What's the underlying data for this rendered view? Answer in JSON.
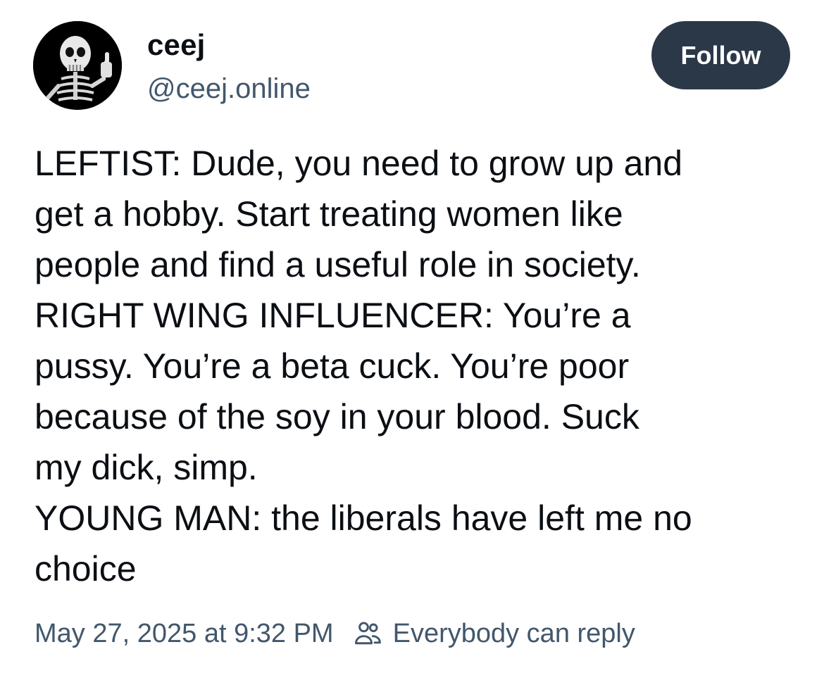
{
  "author": {
    "display_name": "ceej",
    "handle": "@ceej.online",
    "avatar_icon": "skeleton-thumbs-up-avatar"
  },
  "follow_button": {
    "label": "Follow",
    "background": "#2b3847"
  },
  "post": {
    "lines": [
      "LEFTIST: Dude, you need to grow up and",
      "get a hobby. Start treating women like",
      "people and find a useful role in society.",
      "RIGHT WING INFLUENCER: You’re a",
      "pussy. You’re a beta cuck. You’re poor",
      "because of the soy in your blood. Suck",
      "my dick, simp.",
      "YOUNG MAN: the liberals have left me no",
      "choice"
    ]
  },
  "meta": {
    "timestamp": "May 27, 2025 at 9:32 PM",
    "reply_icon": "people-icon",
    "reply_setting": "Everybody can reply"
  },
  "colors": {
    "text": "#0b0f14",
    "secondary_text": "#42576c"
  }
}
